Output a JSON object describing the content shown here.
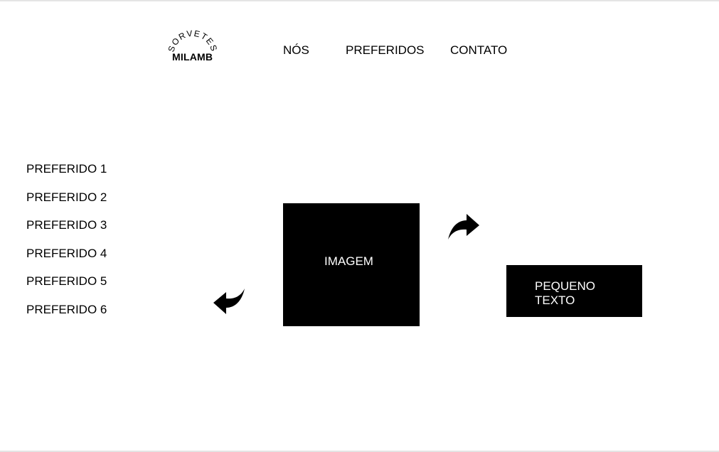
{
  "logo": {
    "arc_text": "SORVETES",
    "name": "MILAMB"
  },
  "nav": {
    "items": [
      {
        "label": "NÓS"
      },
      {
        "label": "PREFERIDOS"
      },
      {
        "label": "CONTATO"
      }
    ]
  },
  "favorites": {
    "items": [
      {
        "label": "PREFERIDO 1"
      },
      {
        "label": "PREFERIDO 2"
      },
      {
        "label": "PREFERIDO 3"
      },
      {
        "label": "PREFERIDO 4"
      },
      {
        "label": "PREFERIDO 5"
      },
      {
        "label": "PREFERIDO 6"
      }
    ]
  },
  "carousel": {
    "image_label": "IMAGEM",
    "next_icon": "curved-arrow-right-icon",
    "prev_icon": "curved-arrow-left-icon"
  },
  "text_box": {
    "label": "PEQUENO TEXTO"
  },
  "colors": {
    "background": "#ffffff",
    "blocks": "#000000",
    "block_text": "#ffffff"
  }
}
